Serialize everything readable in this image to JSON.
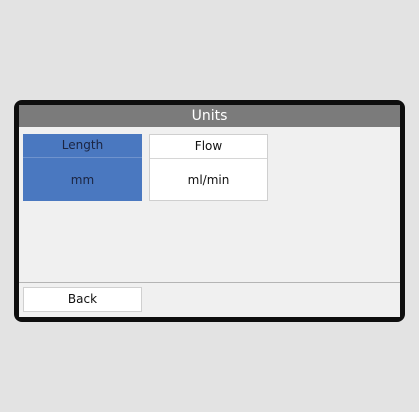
{
  "screen": {
    "title": "Units"
  },
  "units": [
    {
      "label": "Length",
      "value": "mm",
      "selected": true
    },
    {
      "label": "Flow",
      "value": "ml/min",
      "selected": false
    }
  ],
  "footer": {
    "back_label": "Back"
  },
  "colors": {
    "page_background": "#e3e3e3",
    "frame": "#0e0e0e",
    "title_bar": "#7b7b7b",
    "screen_background": "#f0f0f0",
    "selected_tile": "#4a78c0",
    "tile": "#ffffff"
  }
}
